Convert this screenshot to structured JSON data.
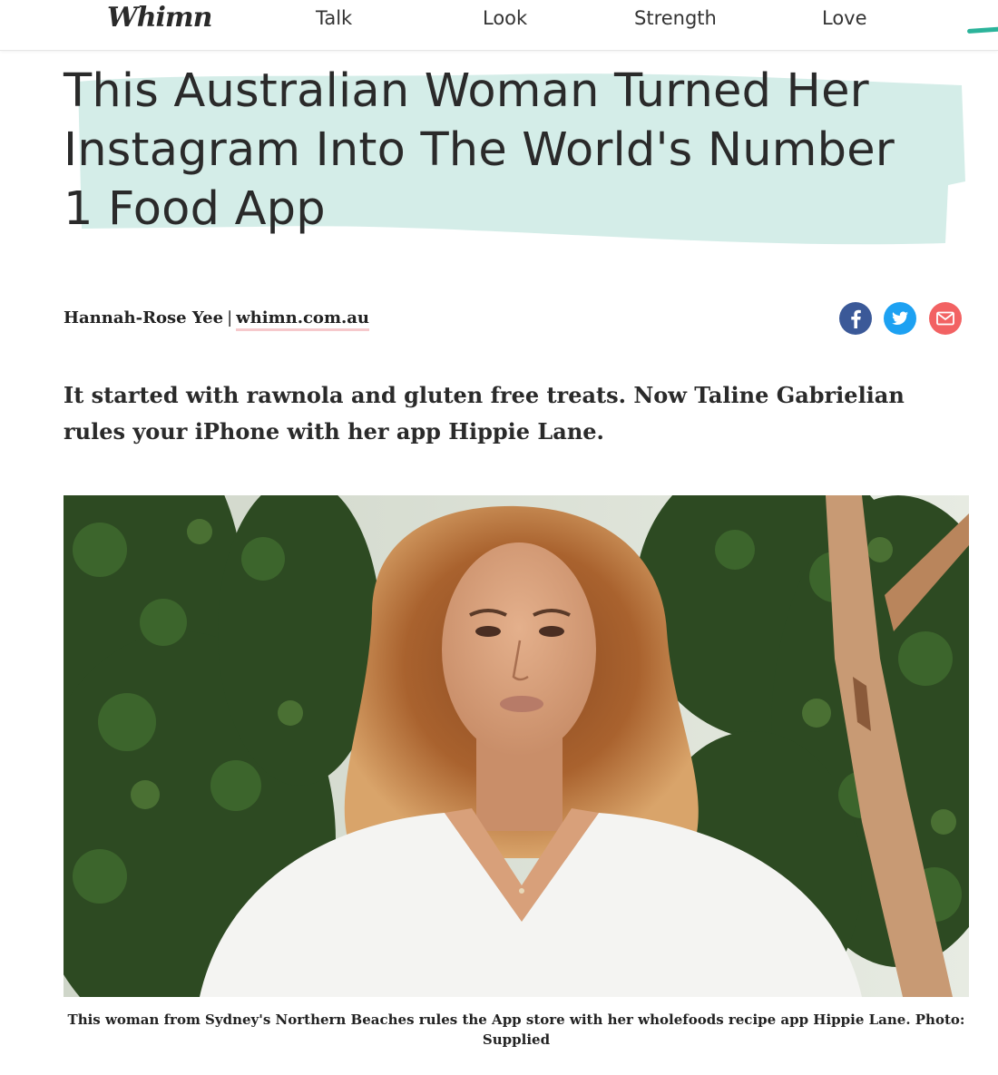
{
  "nav": {
    "logo": "Whimn",
    "links": [
      "Talk",
      "Look",
      "Strength",
      "Love"
    ]
  },
  "article": {
    "headline": "This Australian Woman Turned Her Instagram Into The World's Number 1 Food App",
    "author": "Hannah-Rose Yee",
    "separator": "|",
    "source": "whimn.com.au",
    "standfirst": "It started with rawnola and gluten free treats. Now Taline Gabrielian rules your iPhone with her app Hippie Lane.",
    "caption": "This woman from Sydney's Northern Beaches rules the App store with her wholefoods recipe app Hippie Lane. Photo: Supplied"
  },
  "share": {
    "icons": [
      "facebook-icon",
      "twitter-icon",
      "email-icon"
    ]
  },
  "colors": {
    "highlight": "#d4ede8",
    "accent": "#2bb39a",
    "link_underline": "#f6c9cc",
    "facebook": "#3b5998",
    "twitter": "#1da1f2",
    "email": "#f26263"
  }
}
